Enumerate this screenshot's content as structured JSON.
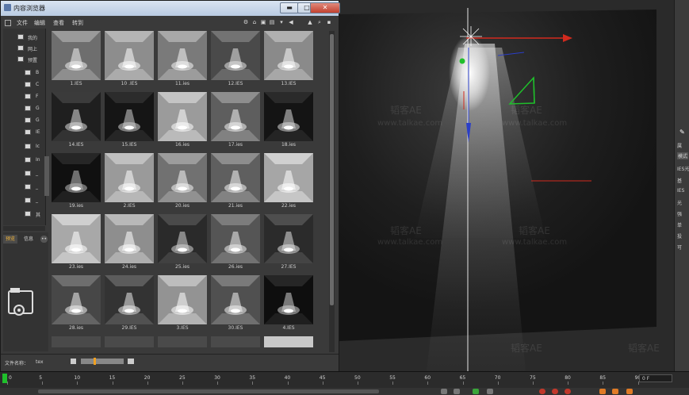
{
  "window": {
    "title": "内容浏览器",
    "controls": {
      "minimize": "▬",
      "maximize": "□",
      "close": "✕"
    }
  },
  "menu": [
    "文件",
    "编辑",
    "查看",
    "转到"
  ],
  "tree": {
    "items": [
      {
        "label": "我的"
      },
      {
        "label": "网上"
      },
      {
        "label": "预置"
      },
      {
        "label": "B"
      },
      {
        "label": "C"
      },
      {
        "label": "F"
      },
      {
        "label": "G"
      },
      {
        "label": "G"
      },
      {
        "label": "IE"
      },
      {
        "label": "Ic"
      },
      {
        "label": "In"
      },
      {
        "label": "_"
      },
      {
        "label": "_"
      },
      {
        "label": "_"
      },
      {
        "label": "其"
      }
    ]
  },
  "preview_tabs": [
    {
      "label": "预览"
    },
    {
      "label": "信息"
    }
  ],
  "status": {
    "label": "文件名称：",
    "value": "tex"
  },
  "grid": {
    "items": [
      {
        "label": "1.IES"
      },
      {
        "label": "10 .IES"
      },
      {
        "label": "11.ies"
      },
      {
        "label": "12.IES"
      },
      {
        "label": "13.IES"
      },
      {
        "label": "14.IES"
      },
      {
        "label": "15.IES"
      },
      {
        "label": "16.ies"
      },
      {
        "label": "17.ies"
      },
      {
        "label": "18.ies"
      },
      {
        "label": "19.ies"
      },
      {
        "label": "2.IES"
      },
      {
        "label": "20.ies"
      },
      {
        "label": "21.ies"
      },
      {
        "label": "22.ies"
      },
      {
        "label": "23.ies"
      },
      {
        "label": "24.ies"
      },
      {
        "label": "25.ies"
      },
      {
        "label": "26.ies"
      },
      {
        "label": "27.IES"
      },
      {
        "label": "28.ies"
      },
      {
        "label": "29.IES"
      },
      {
        "label": "3.IES"
      },
      {
        "label": "30.IES"
      },
      {
        "label": "4.IES"
      }
    ]
  },
  "right_panel": [
    "属",
    "模式",
    "IES光",
    "基",
    "IES",
    "光",
    "强",
    "单",
    "投",
    "可"
  ],
  "timeline": {
    "ticks": [
      "0",
      "5",
      "10",
      "15",
      "20",
      "25",
      "30",
      "35",
      "40",
      "45",
      "50",
      "55",
      "60",
      "65",
      "70",
      "75",
      "80",
      "85",
      "90"
    ],
    "frame": "0 F"
  },
  "watermark": {
    "brand": "韬客AE",
    "url": "www.talkae.com"
  }
}
